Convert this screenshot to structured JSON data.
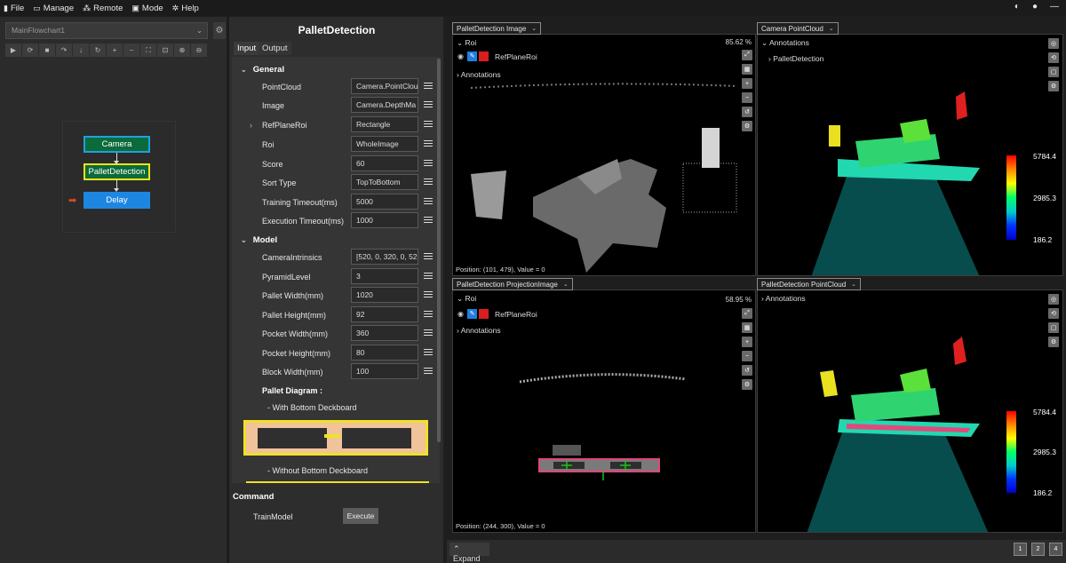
{
  "menubar": {
    "items": [
      {
        "icon": "file-icon",
        "label": "File"
      },
      {
        "icon": "manage-icon",
        "label": "Manage"
      },
      {
        "icon": "remote-icon",
        "label": "Remote"
      },
      {
        "icon": "mode-icon",
        "label": "Mode"
      },
      {
        "icon": "help-icon",
        "label": "Help"
      }
    ]
  },
  "flowchart": {
    "selected": "MainFlowchart1",
    "nodes": [
      "Camera",
      "PalletDetection",
      "Delay"
    ]
  },
  "props": {
    "title": "PalletDetection",
    "tabs": [
      "Input",
      "Output"
    ],
    "general": {
      "header": "General",
      "rows": [
        {
          "label": "PointCloud",
          "value": "Camera.PointClou"
        },
        {
          "label": "Image",
          "value": "Camera.DepthMa"
        },
        {
          "label": "RefPlaneRoi",
          "value": "Rectangle"
        },
        {
          "label": "Roi",
          "value": "WholeImage"
        },
        {
          "label": "Score",
          "value": "60"
        },
        {
          "label": "Sort Type",
          "value": "TopToBottom"
        },
        {
          "label": "Training Timeout(ms)",
          "value": "5000"
        },
        {
          "label": "Execution Timeout(ms)",
          "value": "1000"
        }
      ]
    },
    "model": {
      "header": "Model",
      "rows": [
        {
          "label": "CameraIntrinsics",
          "value": "[520, 0, 320, 0, 52"
        },
        {
          "label": "PyramidLevel",
          "value": "3"
        },
        {
          "label": "Pallet Width(mm)",
          "value": "1020"
        },
        {
          "label": "Pallet Height(mm)",
          "value": "92"
        },
        {
          "label": "Pocket Width(mm)",
          "value": "360"
        },
        {
          "label": "Pocket Height(mm)",
          "value": "80"
        },
        {
          "label": "Block Width(mm)",
          "value": "100"
        }
      ]
    },
    "diagram_title": "Pallet Diagram :",
    "diagram_with": "-  With Bottom Deckboard",
    "diagram_without": "-  Without Bottom Deckboard",
    "command": {
      "title": "Command",
      "label": "TrainModel",
      "button": "Execute"
    }
  },
  "viewers": {
    "v1": {
      "title": "PalletDetection Image",
      "roi": "Roi",
      "zoom": "85.62 %",
      "ref": "RefPlaneRoi",
      "annotations": "Annotations",
      "position": "Position: (101, 479), Value = 0"
    },
    "v2": {
      "title": "Camera PointCloud",
      "annotations": "Annotations",
      "child": "PalletDetection",
      "cb_max": "5784.4",
      "cb_mid": "2985.3",
      "cb_min": "186.2"
    },
    "v3": {
      "title": "PalletDetection ProjectionImage",
      "roi": "Roi",
      "zoom": "58.95 %",
      "ref": "RefPlaneRoi",
      "annotations": "Annotations",
      "position": "Position: (244, 300), Value = 0"
    },
    "v4": {
      "title": "PalletDetection PointCloud",
      "annotations": "Annotations",
      "cb_max": "5784.4",
      "cb_mid": "2985.3",
      "cb_min": "186.2"
    }
  },
  "bottom": {
    "expand": "Expand",
    "layouts": [
      "1",
      "2",
      "4"
    ]
  }
}
